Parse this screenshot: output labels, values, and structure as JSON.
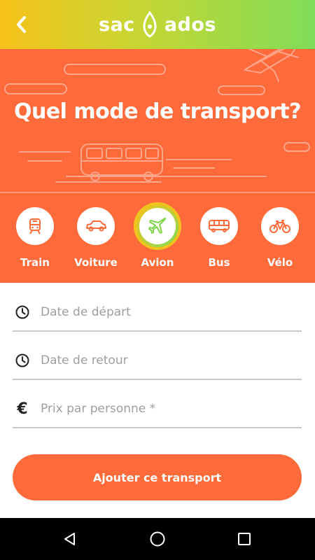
{
  "app": {
    "logo_left": "sac",
    "logo_right": "ados",
    "accent_color": "#ff6a3a",
    "gradient": [
      "#f6c21a",
      "#7fdc58"
    ]
  },
  "hero": {
    "title": "Quel mode de transport?"
  },
  "modes": [
    {
      "label": "Train",
      "icon": "train-icon",
      "selected": false
    },
    {
      "label": "Voiture",
      "icon": "car-icon",
      "selected": false
    },
    {
      "label": "Avion",
      "icon": "plane-icon",
      "selected": true
    },
    {
      "label": "Bus",
      "icon": "bus-icon",
      "selected": false
    },
    {
      "label": "Vélo",
      "icon": "bike-icon",
      "selected": false
    }
  ],
  "form": {
    "departure_placeholder": "Date de départ",
    "return_placeholder": "Date de retour",
    "price_placeholder": "Prix par personne *",
    "price_symbol": "€",
    "submit_label": "Ajouter ce transport"
  },
  "navigation": {
    "back_icon": "back-arrow-icon",
    "system_buttons": [
      "back-triangle-icon",
      "home-circle-icon",
      "recents-square-icon"
    ]
  }
}
